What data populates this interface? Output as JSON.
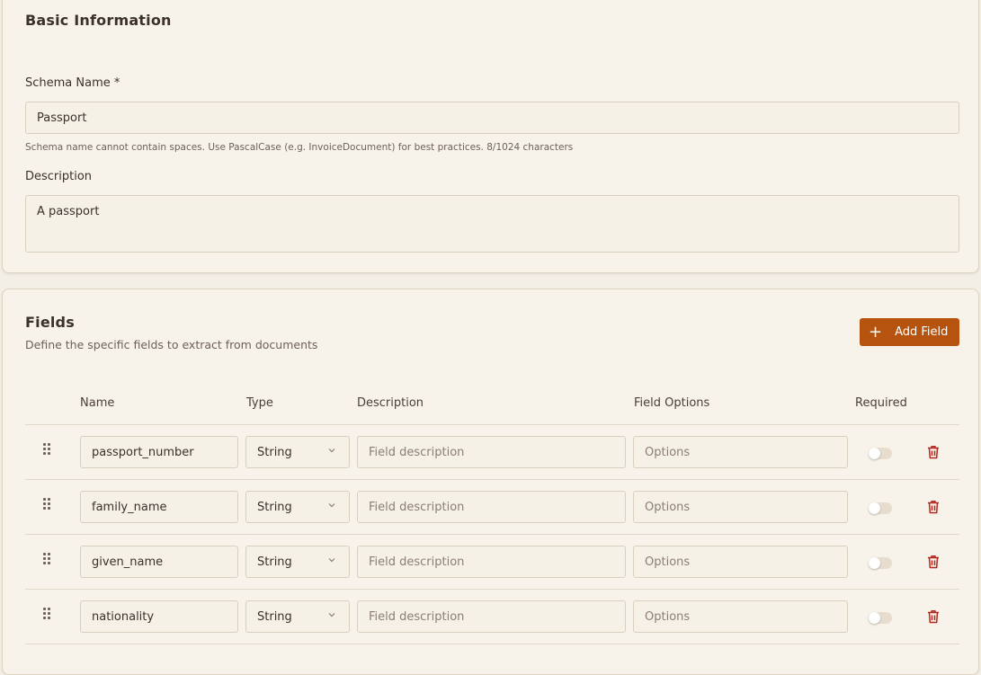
{
  "basic": {
    "title": "Basic Information",
    "schema_name_label": "Schema Name *",
    "schema_name_value": "Passport",
    "schema_name_help": "Schema name cannot contain spaces. Use PascalCase (e.g. InvoiceDocument) for best practices. 8/1024 characters",
    "description_label": "Description",
    "description_value": "A passport"
  },
  "fields": {
    "title": "Fields",
    "subtitle": "Define the specific fields to extract from documents",
    "add_button_label": "Add Field",
    "columns": {
      "name": "Name",
      "type": "Type",
      "description": "Description",
      "field_options": "Field Options",
      "required": "Required"
    },
    "rows": [
      {
        "name": "passport_number",
        "type": "String",
        "description_placeholder": "Field description",
        "options_placeholder": "Options",
        "required": false
      },
      {
        "name": "family_name",
        "type": "String",
        "description_placeholder": "Field description",
        "options_placeholder": "Options",
        "required": false
      },
      {
        "name": "given_name",
        "type": "String",
        "description_placeholder": "Field description",
        "options_placeholder": "Options",
        "required": false
      },
      {
        "name": "nationality",
        "type": "String",
        "description_placeholder": "Field description",
        "options_placeholder": "Options",
        "required": false
      }
    ]
  },
  "colors": {
    "accent": "#b5530f",
    "delete": "#b3261e",
    "background": "#f3efe6"
  },
  "icons": [
    "plus-icon",
    "drag-handle-icon",
    "chevron-down-icon",
    "trash-icon"
  ]
}
